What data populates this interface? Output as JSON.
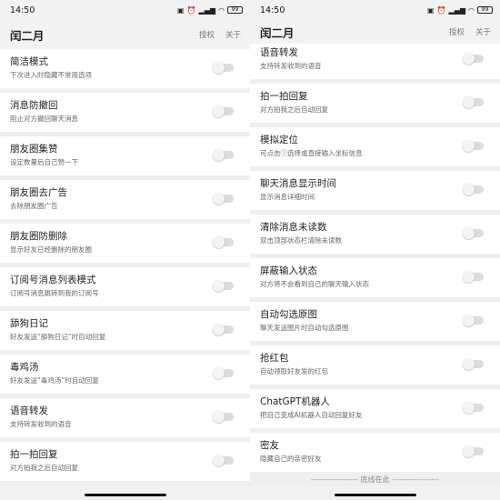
{
  "left_screen": {
    "status": {
      "time": "14:50",
      "battery": "99"
    },
    "app_title": "闰二月",
    "actions": [
      "授权",
      "关于"
    ],
    "items": [
      {
        "title": "简洁模式",
        "desc": "下次进入时隐藏不常用选项",
        "enabled": false
      },
      {
        "title": "消息防撤回",
        "desc": "阻止对方撤回聊天消息",
        "enabled": false
      },
      {
        "title": "朋友圈集赞",
        "desc": "设定数量后自己赞一下",
        "enabled": false
      },
      {
        "title": "朋友圈去广告",
        "desc": "去除朋友圈广告",
        "enabled": false
      },
      {
        "title": "朋友圈防删除",
        "desc": "显示好友已经删除的朋友圈",
        "enabled": false
      },
      {
        "title": "订阅号消息列表模式",
        "desc": "订阅号消息跳转到我的订阅号",
        "enabled": false
      },
      {
        "title": "舔狗日记",
        "desc": "好友发送“舔狗日记”时自动回复",
        "enabled": false
      },
      {
        "title": "毒鸡汤",
        "desc": "好友发送“毒鸡汤”时自动回复",
        "enabled": false
      },
      {
        "title": "语音转发",
        "desc": "支持转发收到的语音",
        "enabled": false
      },
      {
        "title": "拍一拍回复",
        "desc": "对方拍我之后自动回复",
        "enabled": false
      }
    ]
  },
  "right_screen": {
    "status": {
      "time": "14:50",
      "battery": "99"
    },
    "app_title": "闰二月",
    "actions": [
      "授权",
      "关于"
    ],
    "partial_item": {
      "title": "语音转发",
      "desc": "支持转发收到的语音"
    },
    "items": [
      {
        "title": "拍一拍回复",
        "desc": "对方拍我之后自动回复",
        "enabled": false
      },
      {
        "title": "模拟定位",
        "desc": "可点击ⓘ选择或直接输入坐标信息",
        "enabled": false
      },
      {
        "title": "聊天消息显示时间",
        "desc": "显示消息详细时间",
        "enabled": false
      },
      {
        "title": "清除消息未读数",
        "desc": "双击顶部状态栏清除未读数",
        "enabled": false
      },
      {
        "title": "屏蔽输入状态",
        "desc": "对方将不会看到自己的聊天输入状态",
        "enabled": false
      },
      {
        "title": "自动勾选原图",
        "desc": "聊天发送图片时自动勾选原图",
        "enabled": false
      },
      {
        "title": "抢红包",
        "desc": "自动领取好友发的红包",
        "enabled": false
      },
      {
        "title": "ChatGPT机器人",
        "desc": "把自己变成AI机器人自动回复好友",
        "enabled": false
      },
      {
        "title": "密友",
        "desc": "隐藏自己的亲密好友",
        "enabled": false
      }
    ],
    "footer": "------------------ 底线在此 ------------------"
  }
}
